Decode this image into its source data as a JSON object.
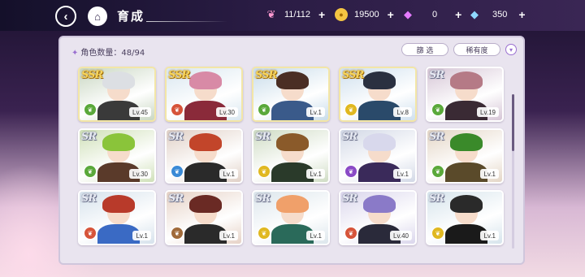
{
  "header": {
    "title": "育成",
    "back_icon": "‹",
    "home_icon": "⌂"
  },
  "resources": [
    {
      "name": "candy",
      "icon": "❦",
      "value": "11/112",
      "plus": "+"
    },
    {
      "name": "coin",
      "icon": "●",
      "value": "19500",
      "plus": "+"
    },
    {
      "name": "gem-paid",
      "icon": "◆",
      "value": "0",
      "plus": "+"
    },
    {
      "name": "gem-free",
      "icon": "◆",
      "value": "350",
      "plus": "+"
    }
  ],
  "panel": {
    "count_label": "角色数量：48/94",
    "spark": "✦",
    "filter_label": "篩 选",
    "sort_label": "稀有度",
    "dropdown_icon": "▾"
  },
  "scroll": {
    "position": 0.0
  },
  "attr_colors": {
    "green": "#5aa83a",
    "red": "#d6543a",
    "yellow": "#e0b820",
    "blue": "#3a8ad6",
    "purple": "#8a4ac6",
    "brown": "#a06a3a"
  },
  "cards": [
    {
      "rarity": "SSR",
      "level": "Lv.45",
      "attr": "green",
      "attr_icon": "❦",
      "bg": "#c9d7c2",
      "hair": "#dcdfe3",
      "outfit": "#3a3a3a"
    },
    {
      "rarity": "SSR",
      "level": "Lv.30",
      "attr": "red",
      "attr_icon": "❦",
      "bg": "#d9e7f0",
      "hair": "#d88aa6",
      "outfit": "#8a2a3a"
    },
    {
      "rarity": "SSR",
      "level": "Lv.1",
      "attr": "green",
      "attr_icon": "❦",
      "bg": "#c8dcea",
      "hair": "#4a2e24",
      "outfit": "#3a5a8a"
    },
    {
      "rarity": "SSR",
      "level": "Lv.8",
      "attr": "yellow",
      "attr_icon": "❦",
      "bg": "#cfe0ee",
      "hair": "#2a3040",
      "outfit": "#2a4a6a"
    },
    {
      "rarity": "SR",
      "level": "Lv.19",
      "attr": "green",
      "attr_icon": "❦",
      "bg": "#d6c6d6",
      "hair": "#b57a86",
      "outfit": "#3a2a34"
    },
    {
      "rarity": "SR",
      "level": "Lv.30",
      "attr": "green",
      "attr_icon": "❦",
      "bg": "#cfe0b8",
      "hair": "#8ac43a",
      "outfit": "#5a3a2a"
    },
    {
      "rarity": "SR",
      "level": "Lv.1",
      "attr": "blue",
      "attr_icon": "❦",
      "bg": "#e0d0c6",
      "hair": "#c2452a",
      "outfit": "#2a2a2a"
    },
    {
      "rarity": "SR",
      "level": "Lv.1",
      "attr": "yellow",
      "attr_icon": "❦",
      "bg": "#cfdcc4",
      "hair": "#8a5a2a",
      "outfit": "#2a3a2a"
    },
    {
      "rarity": "SR",
      "level": "Lv.1",
      "attr": "purple",
      "attr_icon": "❦",
      "bg": "#d2d8e6",
      "hair": "#d8d8ec",
      "outfit": "#3a2a5a"
    },
    {
      "rarity": "SR",
      "level": "Lv.1",
      "attr": "green",
      "attr_icon": "❦",
      "bg": "#e4d6c6",
      "hair": "#3a8a2a",
      "outfit": "#5a4a2a"
    },
    {
      "rarity": "SR",
      "level": "Lv.1",
      "attr": "red",
      "attr_icon": "❦",
      "bg": "#d6e2ec",
      "hair": "#b83a2a",
      "outfit": "#3a6ac4"
    },
    {
      "rarity": "SR",
      "level": "Lv.1",
      "attr": "brown",
      "attr_icon": "❦",
      "bg": "#e6d2c6",
      "hair": "#6a2a24",
      "outfit": "#2a2a2a"
    },
    {
      "rarity": "SR",
      "level": "Lv.1",
      "attr": "yellow",
      "attr_icon": "❦",
      "bg": "#dce6ec",
      "hair": "#f0a06a",
      "outfit": "#2a6a5a"
    },
    {
      "rarity": "SR",
      "level": "Lv.40",
      "attr": "red",
      "attr_icon": "❦",
      "bg": "#dad6ec",
      "hair": "#8a7ac8",
      "outfit": "#2a2a3a"
    },
    {
      "rarity": "SR",
      "level": "Lv.1",
      "attr": "yellow",
      "attr_icon": "❦",
      "bg": "#d6e4ec",
      "hair": "#2a2a2a",
      "outfit": "#1a1a1a"
    }
  ]
}
